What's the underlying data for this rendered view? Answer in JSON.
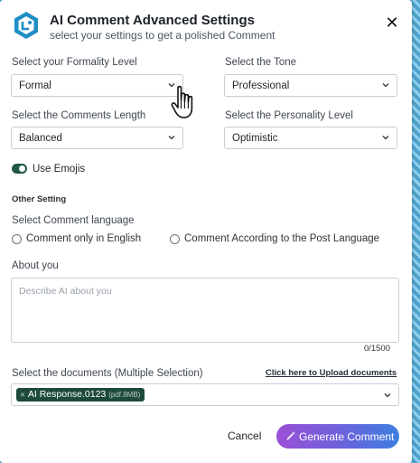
{
  "dialog": {
    "title": "AI Comment Advanced Settings",
    "subtitle": "select your settings to get a polished Comment",
    "close_icon": "close-icon"
  },
  "formality": {
    "label": "Select your Formality Level",
    "value": "Formal"
  },
  "tone": {
    "label": "Select the Tone",
    "value": "Professional"
  },
  "length": {
    "label": "Select the Comments Length",
    "value": "Balanced"
  },
  "personality": {
    "label": "Select the Personality Level",
    "value": "Optimistic"
  },
  "emojis": {
    "label": "Use Emojis",
    "enabled": true
  },
  "other": {
    "section_title": "Other Setting",
    "language_label": "Select Comment language",
    "options": [
      "Comment only in English",
      "Comment According to the Post Language"
    ]
  },
  "about": {
    "label": "About you",
    "placeholder": "Describe AI about you",
    "counter": "0/1500"
  },
  "documents": {
    "label": "Select the documents (Multiple Selection)",
    "upload_link": "Click here to Upload documents",
    "selected": [
      {
        "name": "AI Response.0123",
        "meta": "(pdf.8MB)"
      }
    ]
  },
  "footer": {
    "cancel": "Cancel",
    "generate": "Generate Comment"
  },
  "colors": {
    "toggle_on": "#1f5a42",
    "chip_bg": "#1e4a3e",
    "gradient_start": "#9b4fd6",
    "gradient_end": "#3d7fe0"
  }
}
